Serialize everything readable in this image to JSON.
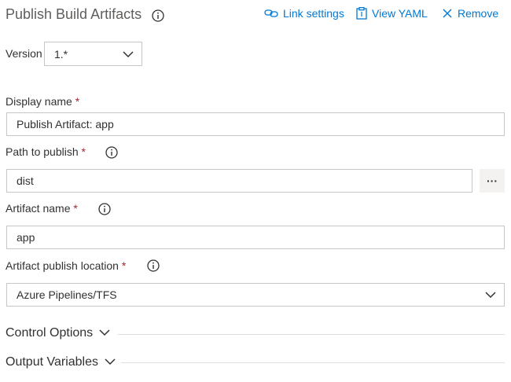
{
  "header": {
    "title": "Publish Build Artifacts",
    "info_icon": "info-icon",
    "link_settings": {
      "label": "Link settings",
      "icon": "link-icon"
    },
    "view_yaml": {
      "label": "View YAML",
      "icon": "clipboard-icon"
    },
    "remove": {
      "label": "Remove",
      "icon": "close-icon"
    }
  },
  "version": {
    "label": "Version",
    "value": "1.*"
  },
  "fields": {
    "display_name": {
      "label": "Display name",
      "required": "*",
      "value": "Publish Artifact: app"
    },
    "path_to_publish": {
      "label": "Path to publish",
      "required": "*",
      "value": "dist",
      "browse": "···"
    },
    "artifact_name": {
      "label": "Artifact name",
      "required": "*",
      "value": "app"
    },
    "publish_location": {
      "label": "Artifact publish location",
      "required": "*",
      "value": "Azure Pipelines/TFS"
    }
  },
  "sections": {
    "control_options": "Control Options",
    "output_variables": "Output Variables"
  },
  "colors": {
    "accent": "#0078d4",
    "required": "#a4262c",
    "border": "#c8c6c4"
  }
}
